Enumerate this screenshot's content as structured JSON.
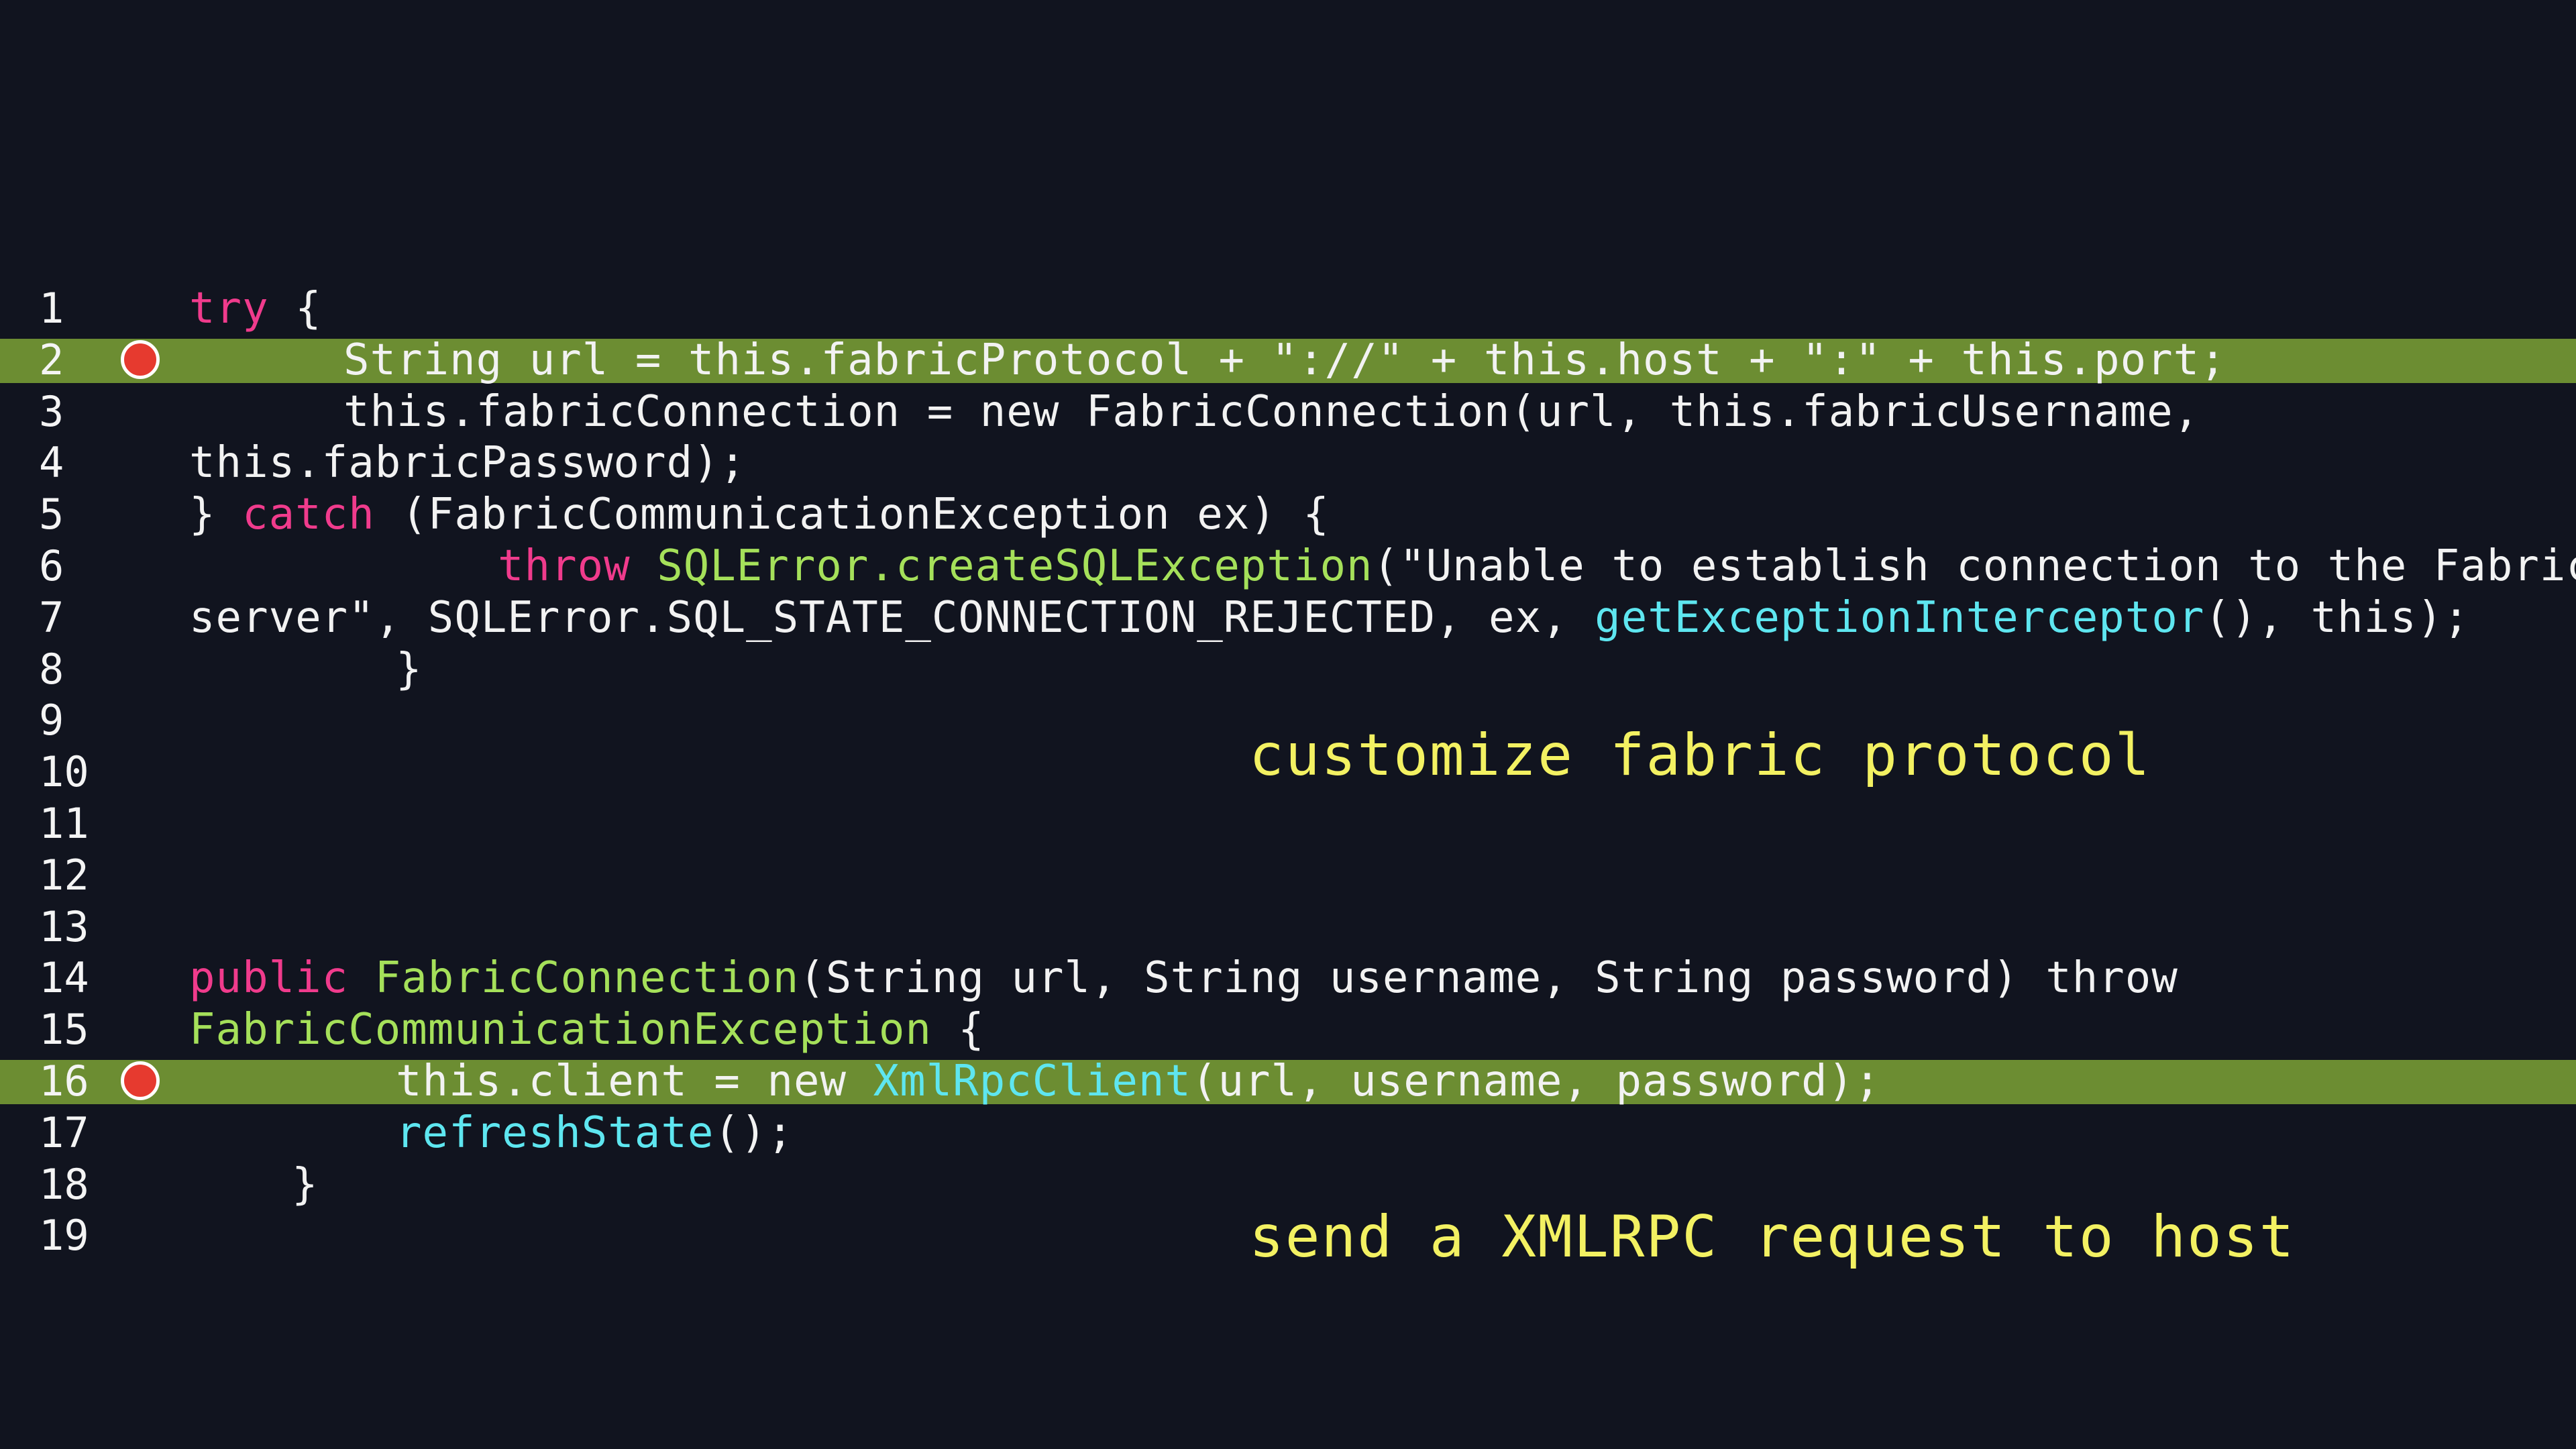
{
  "editor": {
    "lines": [
      {
        "number": "1",
        "breakpoint": false,
        "highlighted": false,
        "indent": 282,
        "tokens": [
          {
            "text": "try",
            "type": "kw"
          },
          {
            "text": " {",
            "type": "pl"
          }
        ]
      },
      {
        "number": "2",
        "breakpoint": true,
        "highlighted": true,
        "indent": 512,
        "tokens": [
          {
            "text": "String url = this.fabricProtocol + \"://\" + this.host + \":\" + this.port;",
            "type": "pl"
          }
        ]
      },
      {
        "number": "3",
        "breakpoint": false,
        "highlighted": false,
        "indent": 512,
        "tokens": [
          {
            "text": "this.fabricConnection = new FabricConnection(url, this.fabricUsername,",
            "type": "pl"
          }
        ]
      },
      {
        "number": "4",
        "breakpoint": false,
        "highlighted": false,
        "indent": 282,
        "tokens": [
          {
            "text": "this.fabricPassword);",
            "type": "pl"
          }
        ]
      },
      {
        "number": "5",
        "breakpoint": false,
        "highlighted": false,
        "indent": 282,
        "tokens": [
          {
            "text": "} ",
            "type": "pl"
          },
          {
            "text": "catch",
            "type": "kw"
          },
          {
            "text": " (FabricCommunicationException ex) {",
            "type": "pl"
          }
        ]
      },
      {
        "number": "6",
        "breakpoint": false,
        "highlighted": false,
        "indent": 742,
        "tokens": [
          {
            "text": "throw",
            "type": "kw"
          },
          {
            "text": " ",
            "type": "pl"
          },
          {
            "text": "SQLError.createSQLException",
            "type": "fn"
          },
          {
            "text": "(\"Unable to establish connection to the Fabric",
            "type": "pl"
          }
        ]
      },
      {
        "number": "7",
        "breakpoint": false,
        "highlighted": false,
        "indent": 282,
        "tokens": [
          {
            "text": "server\", SQLError.SQL_STATE_CONNECTION_REJECTED, ex, ",
            "type": "pl"
          },
          {
            "text": "getExceptionInterceptor",
            "type": "call"
          },
          {
            "text": "(), this);",
            "type": "pl"
          }
        ]
      },
      {
        "number": "8",
        "breakpoint": false,
        "highlighted": false,
        "indent": 590,
        "tokens": [
          {
            "text": "}",
            "type": "pl"
          }
        ]
      },
      {
        "number": "9",
        "breakpoint": false,
        "highlighted": false,
        "indent": 282,
        "tokens": []
      },
      {
        "number": "10",
        "breakpoint": false,
        "highlighted": false,
        "indent": 282,
        "tokens": []
      },
      {
        "number": "11",
        "breakpoint": false,
        "highlighted": false,
        "indent": 282,
        "tokens": []
      },
      {
        "number": "12",
        "breakpoint": false,
        "highlighted": false,
        "indent": 282,
        "tokens": []
      },
      {
        "number": "13",
        "breakpoint": false,
        "highlighted": false,
        "indent": 282,
        "tokens": []
      },
      {
        "number": "14",
        "breakpoint": false,
        "highlighted": false,
        "indent": 282,
        "tokens": [
          {
            "text": "public",
            "type": "kw"
          },
          {
            "text": " ",
            "type": "pl"
          },
          {
            "text": "FabricConnection",
            "type": "fn"
          },
          {
            "text": "(String url, String username, String password) throw",
            "type": "pl"
          }
        ]
      },
      {
        "number": "15",
        "breakpoint": false,
        "highlighted": false,
        "indent": 282,
        "tokens": [
          {
            "text": "FabricCommunicationException",
            "type": "fn"
          },
          {
            "text": " {",
            "type": "pl"
          }
        ]
      },
      {
        "number": "16",
        "breakpoint": true,
        "highlighted": true,
        "indent": 590,
        "tokens": [
          {
            "text": "this.client = new ",
            "type": "pl"
          },
          {
            "text": "XmlRpcClient",
            "type": "call"
          },
          {
            "text": "(url, username, password);",
            "type": "pl"
          }
        ]
      },
      {
        "number": "17",
        "breakpoint": false,
        "highlighted": false,
        "indent": 590,
        "tokens": [
          {
            "text": "refreshState",
            "type": "call"
          },
          {
            "text": "();",
            "type": "pl"
          }
        ]
      },
      {
        "number": "18",
        "breakpoint": false,
        "highlighted": false,
        "indent": 435,
        "tokens": [
          {
            "text": "}",
            "type": "pl"
          }
        ]
      },
      {
        "number": "19",
        "breakpoint": false,
        "highlighted": false,
        "indent": 282,
        "tokens": []
      }
    ]
  },
  "annotations": [
    {
      "text": "customize fabric protocol",
      "name": "annotation-customize-fabric-protocol"
    },
    {
      "text": "send a XMLRPC request to host",
      "name": "annotation-send-xmlrpc-request"
    }
  ],
  "colors": {
    "background": "#11141f",
    "highlight": "#6c8d32",
    "keyword": "#f03b8c",
    "function": "#a5e05a",
    "call": "#5ee6f0",
    "annotation": "#f3f162",
    "breakpoint": "#e63a2f"
  }
}
